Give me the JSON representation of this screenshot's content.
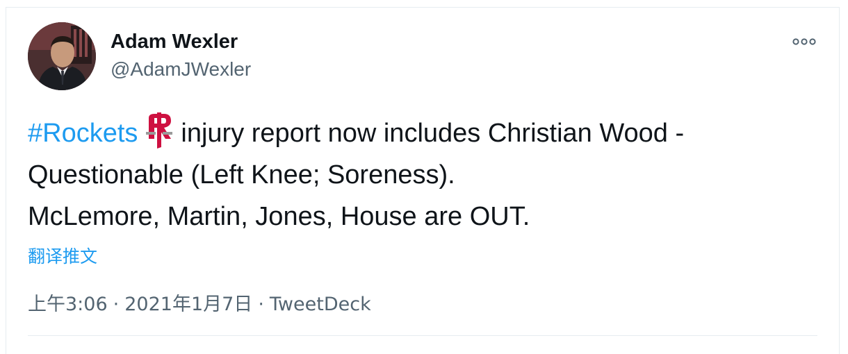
{
  "author": {
    "name": "Adam Wexler",
    "handle": "@AdamJWexler"
  },
  "tweet": {
    "hashtag": "#Rockets",
    "emoji_icon": "houston-rockets-logo-icon",
    "line1_rest": "injury report now includes Christian Wood -",
    "line2": "Questionable (Left Knee; Soreness).",
    "line3": "McLemore, Martin, Jones, House are OUT."
  },
  "translate_label": "翻译推文",
  "meta": {
    "time": "上午3:06",
    "separator": "·",
    "date": "2021年1月7日",
    "source": "TweetDeck"
  },
  "colors": {
    "link": "#1d9bf0",
    "secondary_text": "#536471",
    "primary_text": "#0f1419",
    "rockets_red": "#ce1141"
  },
  "icons": {
    "more": "more-options-icon"
  }
}
